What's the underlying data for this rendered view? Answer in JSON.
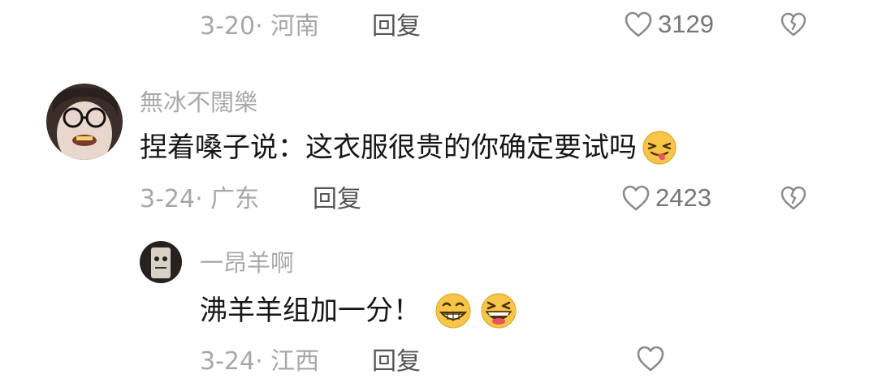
{
  "comments": [
    {
      "date_location": "3-20· 河南",
      "reply_label": "回复",
      "likes": "3129"
    },
    {
      "username": "無冰不闊樂",
      "text": "捏着嗓子说：这衣服很贵的你确定要试吗",
      "emoji": "squinting-tongue-emoji",
      "date_location": "3-24· 广东",
      "reply_label": "回复",
      "likes": "2423",
      "replies": [
        {
          "username": "一昂羊啊",
          "text": "沸羊羊组加一分！",
          "emojis": [
            "grinning-emoji",
            "laughing-emoji"
          ],
          "date_location": "3-24· 江西",
          "reply_label": "回复"
        }
      ]
    }
  ],
  "icons": {
    "like": "heart-outline-icon",
    "dislike": "broken-heart-icon"
  },
  "colors": {
    "meta_text": "#a7a7a7",
    "reply_text": "#555555",
    "body_text": "#161616",
    "icon_gray": "#8a8a8a",
    "emoji_yellow": "#f7c548"
  }
}
